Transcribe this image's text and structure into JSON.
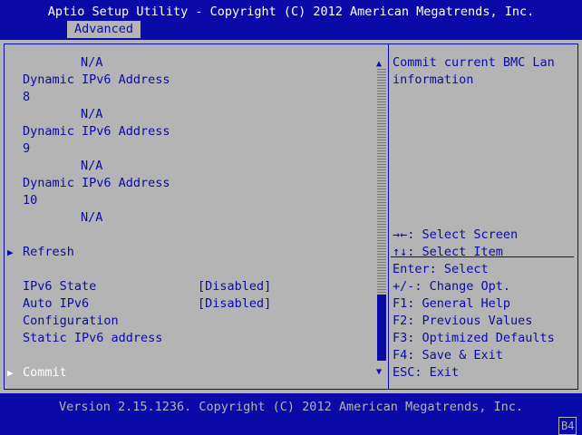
{
  "header": {
    "title": "Aptio Setup Utility - Copyright (C) 2012 American Megatrends, Inc.",
    "tab": "Advanced"
  },
  "main": {
    "lines": [
      {
        "text": "N/A"
      },
      {
        "text": "Dynamic IPv6 Address"
      },
      {
        "text": "8"
      },
      {
        "text": "N/A"
      },
      {
        "text": "Dynamic IPv6 Address"
      },
      {
        "text": "9"
      },
      {
        "text": "N/A"
      },
      {
        "text": "Dynamic IPv6 Address"
      },
      {
        "text": "10"
      },
      {
        "text": "N/A"
      }
    ],
    "refresh": "Refresh",
    "ipv6_state": {
      "label": "IPv6 State",
      "value": "[Disabled]"
    },
    "auto_ipv6": {
      "label": "Auto IPv6",
      "value": "[Disabled]"
    },
    "configuration": "Configuration",
    "static_ipv6": "Static IPv6 address",
    "commit": "Commit",
    "scroll_up": "▲",
    "scroll_down": "▼"
  },
  "help": {
    "description_line1": "Commit current BMC Lan",
    "description_line2": "information",
    "keys": [
      "→←: Select Screen",
      "↑↓: Select Item",
      "Enter: Select",
      "+/-: Change Opt.",
      "F1: General Help",
      "F2: Previous Values",
      "F3: Optimized Defaults",
      "F4: Save & Exit",
      "ESC: Exit"
    ]
  },
  "footer": {
    "version": "Version 2.15.1236. Copyright (C) 2012 American Megatrends, Inc.",
    "badge": "B4"
  }
}
